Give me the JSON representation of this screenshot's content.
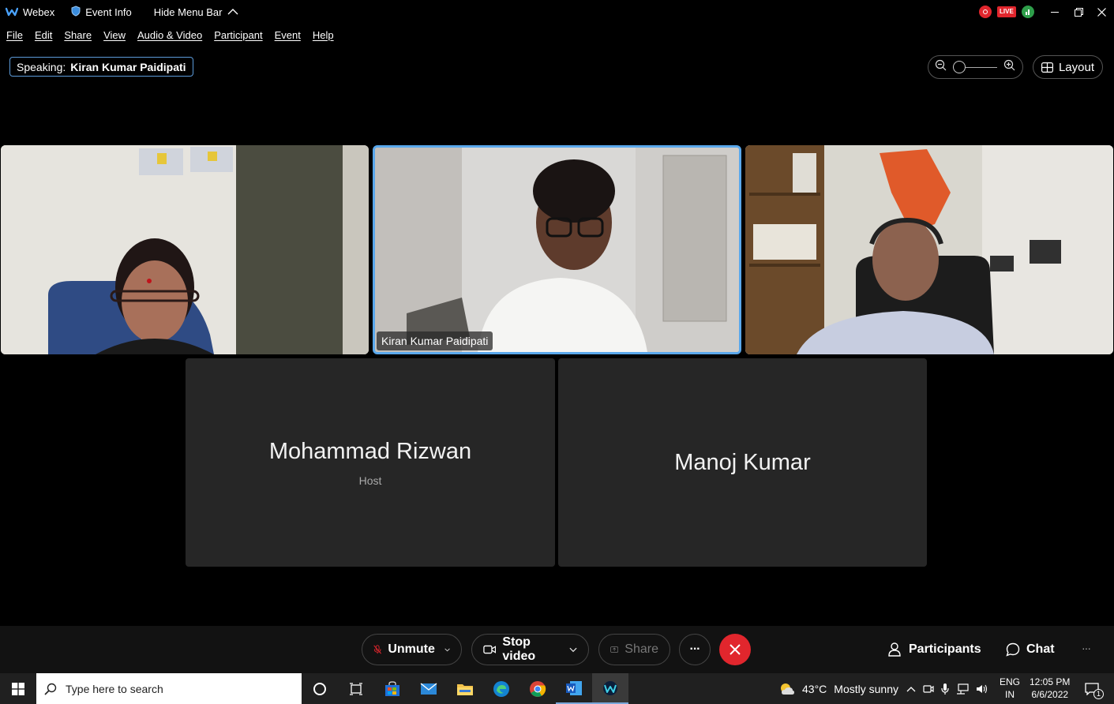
{
  "titlebar": {
    "app_name": "Webex",
    "event_info": "Event Info",
    "hide_menu": "Hide Menu Bar",
    "live_badge": "LIVE"
  },
  "menu": [
    "File",
    "Edit",
    "Share",
    "View",
    "Audio & Video",
    "Participant",
    "Event",
    "Help"
  ],
  "speaking": {
    "label": "Speaking:",
    "name": "Kiran Kumar Paidipati"
  },
  "layout_label": "Layout",
  "video_tiles": [
    {
      "name": ""
    },
    {
      "name": "Kiran Kumar Paidipati"
    },
    {
      "name": ""
    }
  ],
  "participant_tiles": [
    {
      "name": "Mohammad Rizwan",
      "role": "Host"
    },
    {
      "name": "Manoj Kumar",
      "role": ""
    }
  ],
  "controls": {
    "unmute": "Unmute",
    "stop_video": "Stop video",
    "share": "Share",
    "more": "···",
    "participants": "Participants",
    "chat": "Chat",
    "overflow": "···"
  },
  "taskbar": {
    "search_placeholder": "Type here to search",
    "weather_temp": "43°C",
    "weather_desc": "Mostly sunny",
    "lang_1": "ENG",
    "lang_2": "IN",
    "time": "12:05 PM",
    "date": "6/6/2022",
    "notification_count": "1"
  },
  "colors": {
    "accent_blue": "#5b9ad9",
    "leave_red": "#e1262d",
    "bg": "#000000",
    "tile_bg": "#262626"
  }
}
